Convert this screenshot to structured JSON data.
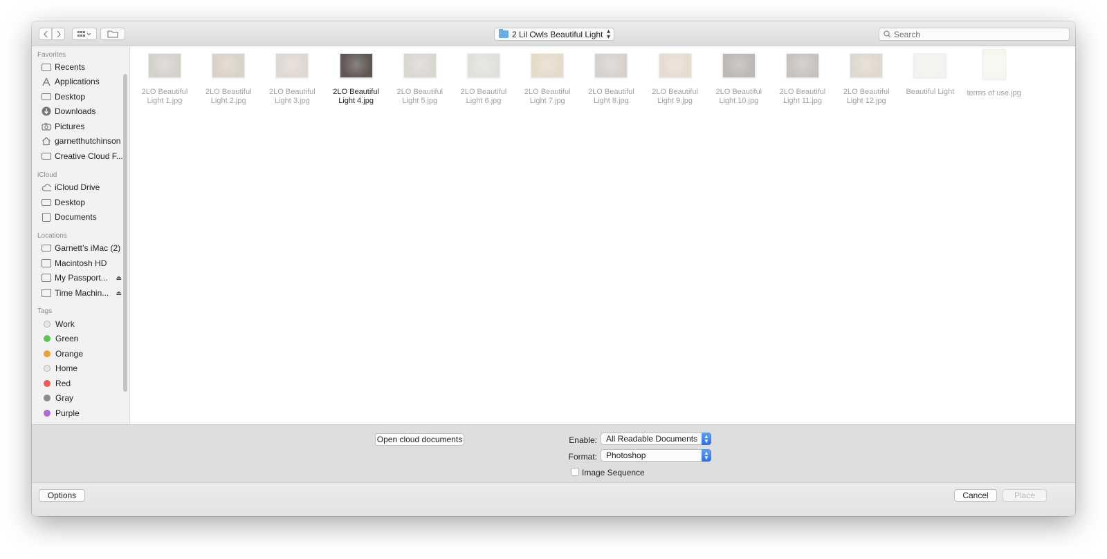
{
  "toolbar": {
    "folder_name": "2 Lil Owls Beautiful Light",
    "search_placeholder": "Search"
  },
  "sidebar": {
    "sections": {
      "favorites": "Favorites",
      "icloud": "iCloud",
      "locations": "Locations",
      "tags": "Tags"
    },
    "favorites": [
      "Recents",
      "Applications",
      "Desktop",
      "Downloads",
      "Pictures",
      "garnetthutchinson",
      "Creative Cloud F..."
    ],
    "icloud": [
      "iCloud Drive",
      "Desktop",
      "Documents"
    ],
    "locations": [
      "Garnett’s iMac (2)",
      "Macintosh HD",
      "My Passport...",
      "Time Machin..."
    ],
    "tags": [
      {
        "label": "Work",
        "color": "#e6e6e6"
      },
      {
        "label": "Green",
        "color": "#5fc454"
      },
      {
        "label": "Orange",
        "color": "#f0a03c"
      },
      {
        "label": "Home",
        "color": "#e6e6e6"
      },
      {
        "label": "Red",
        "color": "#ec5b55"
      },
      {
        "label": "Gray",
        "color": "#8e8e8e"
      },
      {
        "label": "Purple",
        "color": "#b069d6"
      }
    ]
  },
  "files": [
    {
      "line1": "2LO Beautiful",
      "line2": "Light 1.jpg",
      "thumb": "#b9b4ac"
    },
    {
      "line1": "2LO Beautiful",
      "line2": "Light 2.jpg",
      "thumb": "#c2b5a4"
    },
    {
      "line1": "2LO Beautiful",
      "line2": "Light 3.jpg",
      "thumb": "#cdbdb3"
    },
    {
      "line1": "2LO Beautiful",
      "line2": "Light 4.jpg",
      "thumb": "#5e5753",
      "selected": true
    },
    {
      "line1": "2LO Beautiful",
      "line2": "Light 5.jpg",
      "thumb": "#c3bcb4"
    },
    {
      "line1": "2LO Beautiful",
      "line2": "Light 6.jpg",
      "thumb": "#cfccc6"
    },
    {
      "line1": "2LO Beautiful",
      "line2": "Light 7.jpg",
      "thumb": "#d6c4a8"
    },
    {
      "line1": "2LO Beautiful",
      "line2": "Light 8.jpg",
      "thumb": "#bdb4ad"
    },
    {
      "line1": "2LO Beautiful",
      "line2": "Light 9.jpg",
      "thumb": "#d8c6b2"
    },
    {
      "line1": "2LO Beautiful",
      "line2": "Light 10.jpg",
      "thumb": "#8f8a86"
    },
    {
      "line1": "2LO Beautiful",
      "line2": "Light 11.jpg",
      "thumb": "#a39b92"
    },
    {
      "line1": "2LO Beautiful",
      "line2": "Light 12.jpg",
      "thumb": "#cbbfae"
    },
    {
      "line1": "Beautiful Light",
      "line2": "",
      "thumb": "#ecebe6"
    },
    {
      "line1": "terms of use.jpg",
      "line2": "",
      "thumb": "#f4f2e6"
    }
  ],
  "options_panel": {
    "cloud_button": "Open cloud documents",
    "enable_label": "Enable:",
    "enable_value": "All Readable Documents",
    "format_label": "Format:",
    "format_value": "Photoshop",
    "image_sequence_label": "Image Sequence"
  },
  "footer": {
    "options_button": "Options",
    "cancel_button": "Cancel",
    "place_button": "Place"
  }
}
